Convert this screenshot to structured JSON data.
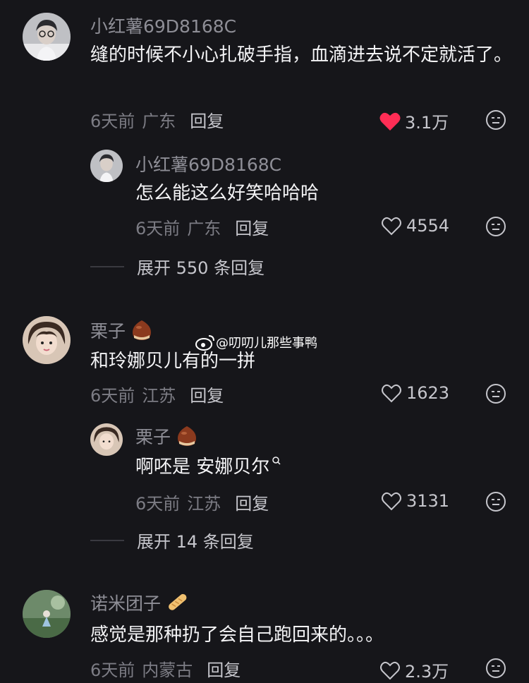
{
  "watermark": "@叨叨儿那些事鸭",
  "comments": [
    {
      "user": "小红薯69D8168C",
      "text": "缝的时候不小心扎破手指，血滴进去说不定就活了。",
      "time": "6天前",
      "region": "广东",
      "reply": "回复",
      "likes": "3.1万",
      "liked": true,
      "subreply": {
        "user": "小红薯69D8168C",
        "text": "怎么能这么好笑哈哈哈",
        "time": "6天前",
        "region": "广东",
        "reply": "回复",
        "likes": "4554"
      },
      "expand": "展开 550 条回复"
    },
    {
      "user": "栗子",
      "text": "和玲娜贝儿有的一拼",
      "time": "6天前",
      "region": "江苏",
      "reply": "回复",
      "likes": "1623",
      "subreply": {
        "user": "栗子",
        "text": "啊呸是 安娜贝尔",
        "time": "6天前",
        "region": "江苏",
        "reply": "回复",
        "likes": "3131"
      },
      "expand": "展开 14 条回复"
    },
    {
      "user": "诺米团子",
      "text": "感觉是那种扔了会自己跑回来的。。。",
      "time": "6天前",
      "region": "内蒙古",
      "reply": "回复",
      "likes": "2.3万"
    }
  ],
  "colors": {
    "background": "#16161a",
    "like_active": "#ff2d55",
    "secondary": "#8e8e96"
  },
  "icons": [
    "heart-icon",
    "heart-outline-icon",
    "emoji-icon",
    "chestnut-icon",
    "bread-icon",
    "weibo-icon"
  ]
}
